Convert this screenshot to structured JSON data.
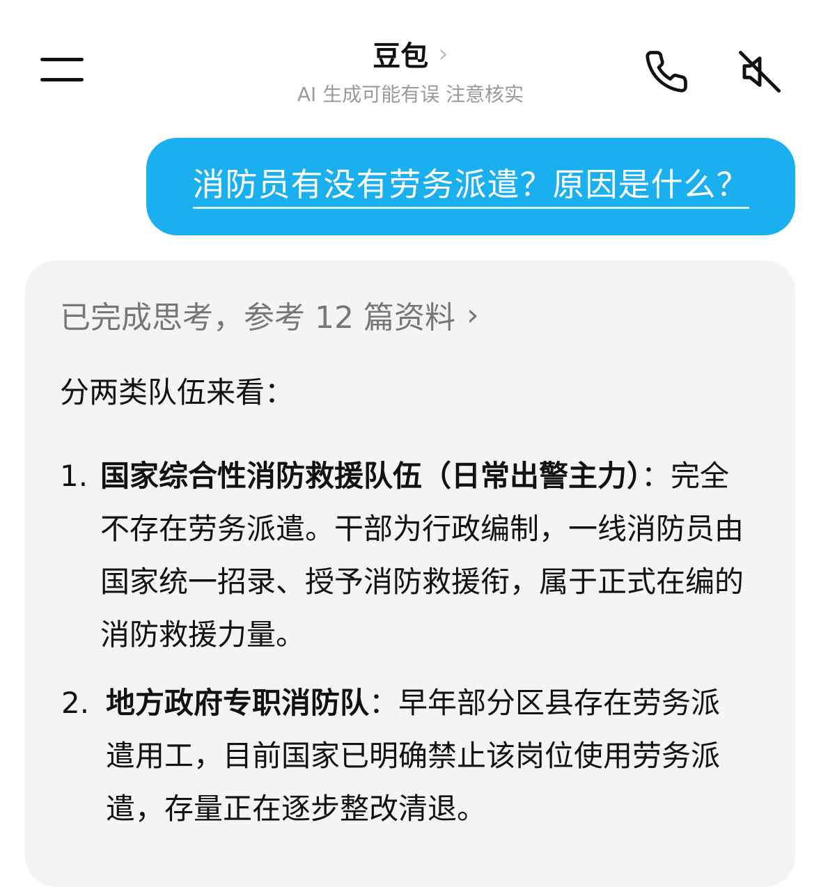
{
  "header": {
    "title": "豆包",
    "title_chevron": "›",
    "subtitle": "AI 生成可能有误 注意核实",
    "icons": {
      "menu": "menu-icon",
      "phone": "phone-icon",
      "mute": "speaker-mute-icon",
      "chevron": "chevron-right-icon"
    }
  },
  "user_message": {
    "text": "消防员有没有劳务派遣？原因是什么？",
    "bubble_color": "#1ab0f0"
  },
  "ai_response": {
    "thinking_status": "已完成思考，参考 12 篇资料",
    "thinking_chevron": "›",
    "intro": "分两类队伍来看：",
    "items": [
      {
        "number": "1.",
        "heading": "国家综合性消防救援队伍（日常出警主力）",
        "separator": "：",
        "body": "完全不存在劳务派遣。干部为行政编制，一线消防员由国家统一招录、授予消防救援衔，属于正式在编的消防救援力量。"
      },
      {
        "number": "2.",
        "heading": "地方政府专职消防队",
        "separator": "：",
        "body": "早年部分区县存在劳务派遣用工，目前国家已明确禁止该岗位使用劳务派遣，存量正在逐步整改清退。"
      }
    ]
  }
}
